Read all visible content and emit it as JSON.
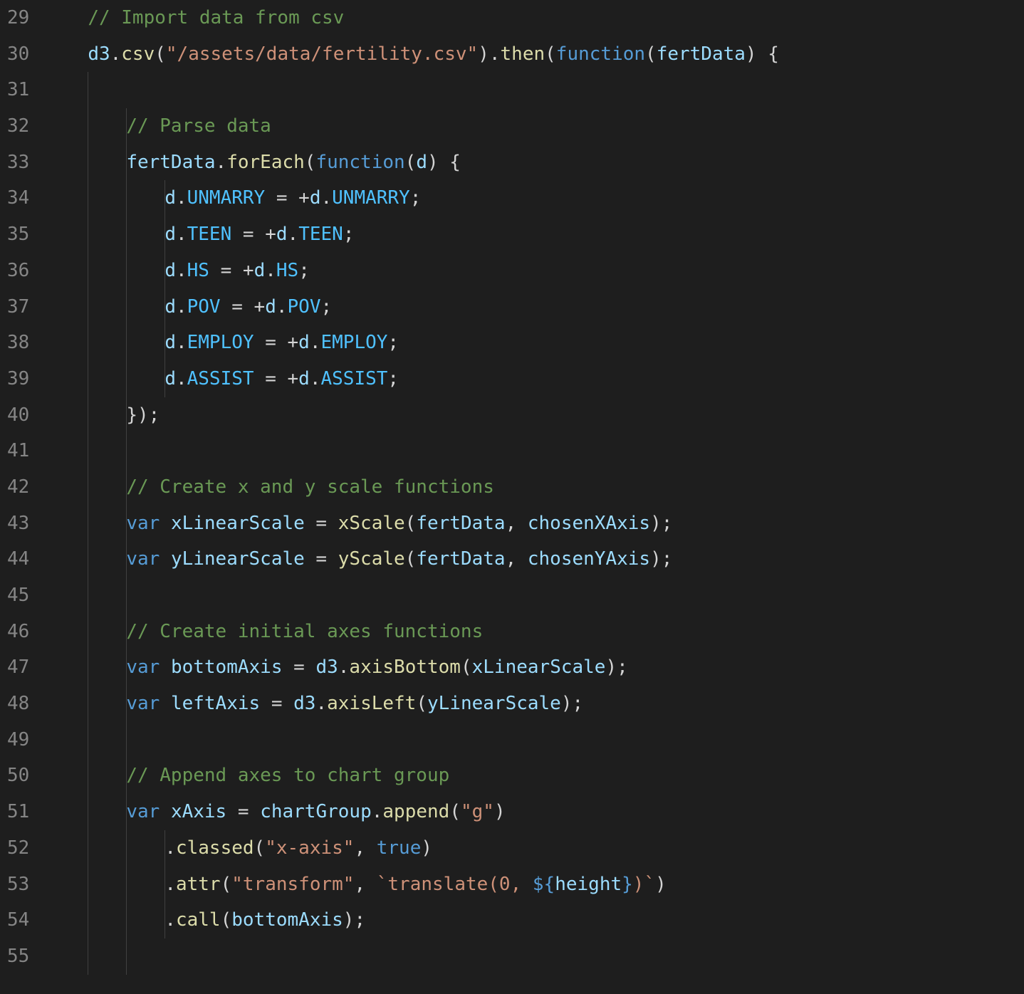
{
  "startLine": 29,
  "indentWidth": 54,
  "lines": [
    {
      "indent": 1,
      "tokens": [
        {
          "cls": "tok-comment",
          "text": "// Import data from csv"
        }
      ]
    },
    {
      "indent": 1,
      "tokens": [
        {
          "cls": "tok-var",
          "text": "d3"
        },
        {
          "cls": "tok-plain",
          "text": "."
        },
        {
          "cls": "tok-func",
          "text": "csv"
        },
        {
          "cls": "tok-plain",
          "text": "("
        },
        {
          "cls": "tok-string",
          "text": "\"/assets/data/fertility.csv\""
        },
        {
          "cls": "tok-plain",
          "text": ")."
        },
        {
          "cls": "tok-func",
          "text": "then"
        },
        {
          "cls": "tok-plain",
          "text": "("
        },
        {
          "cls": "tok-type",
          "text": "function"
        },
        {
          "cls": "tok-plain",
          "text": "("
        },
        {
          "cls": "tok-var",
          "text": "fertData"
        },
        {
          "cls": "tok-plain",
          "text": ") {"
        }
      ]
    },
    {
      "indent": 1,
      "guides": [
        1
      ],
      "tokens": []
    },
    {
      "indent": 2,
      "guides": [
        1,
        2
      ],
      "tokens": [
        {
          "cls": "tok-comment",
          "text": "// Parse data"
        }
      ]
    },
    {
      "indent": 2,
      "guides": [
        1,
        2
      ],
      "tokens": [
        {
          "cls": "tok-var",
          "text": "fertData"
        },
        {
          "cls": "tok-plain",
          "text": "."
        },
        {
          "cls": "tok-func",
          "text": "forEach"
        },
        {
          "cls": "tok-plain",
          "text": "("
        },
        {
          "cls": "tok-type",
          "text": "function"
        },
        {
          "cls": "tok-plain",
          "text": "("
        },
        {
          "cls": "tok-var",
          "text": "d"
        },
        {
          "cls": "tok-plain",
          "text": ") {"
        }
      ]
    },
    {
      "indent": 3,
      "guides": [
        1,
        2,
        3
      ],
      "tokens": [
        {
          "cls": "tok-var",
          "text": "d"
        },
        {
          "cls": "tok-plain",
          "text": "."
        },
        {
          "cls": "tok-const",
          "text": "UNMARRY"
        },
        {
          "cls": "tok-plain",
          "text": " = +"
        },
        {
          "cls": "tok-var",
          "text": "d"
        },
        {
          "cls": "tok-plain",
          "text": "."
        },
        {
          "cls": "tok-const",
          "text": "UNMARRY"
        },
        {
          "cls": "tok-plain",
          "text": ";"
        }
      ]
    },
    {
      "indent": 3,
      "guides": [
        1,
        2,
        3
      ],
      "tokens": [
        {
          "cls": "tok-var",
          "text": "d"
        },
        {
          "cls": "tok-plain",
          "text": "."
        },
        {
          "cls": "tok-const",
          "text": "TEEN"
        },
        {
          "cls": "tok-plain",
          "text": " = +"
        },
        {
          "cls": "tok-var",
          "text": "d"
        },
        {
          "cls": "tok-plain",
          "text": "."
        },
        {
          "cls": "tok-const",
          "text": "TEEN"
        },
        {
          "cls": "tok-plain",
          "text": ";"
        }
      ]
    },
    {
      "indent": 3,
      "guides": [
        1,
        2,
        3
      ],
      "tokens": [
        {
          "cls": "tok-var",
          "text": "d"
        },
        {
          "cls": "tok-plain",
          "text": "."
        },
        {
          "cls": "tok-const",
          "text": "HS"
        },
        {
          "cls": "tok-plain",
          "text": " = +"
        },
        {
          "cls": "tok-var",
          "text": "d"
        },
        {
          "cls": "tok-plain",
          "text": "."
        },
        {
          "cls": "tok-const",
          "text": "HS"
        },
        {
          "cls": "tok-plain",
          "text": ";"
        }
      ]
    },
    {
      "indent": 3,
      "guides": [
        1,
        2,
        3
      ],
      "tokens": [
        {
          "cls": "tok-var",
          "text": "d"
        },
        {
          "cls": "tok-plain",
          "text": "."
        },
        {
          "cls": "tok-const",
          "text": "POV"
        },
        {
          "cls": "tok-plain",
          "text": " = +"
        },
        {
          "cls": "tok-var",
          "text": "d"
        },
        {
          "cls": "tok-plain",
          "text": "."
        },
        {
          "cls": "tok-const",
          "text": "POV"
        },
        {
          "cls": "tok-plain",
          "text": ";"
        }
      ]
    },
    {
      "indent": 3,
      "guides": [
        1,
        2,
        3
      ],
      "tokens": [
        {
          "cls": "tok-var",
          "text": "d"
        },
        {
          "cls": "tok-plain",
          "text": "."
        },
        {
          "cls": "tok-const",
          "text": "EMPLOY"
        },
        {
          "cls": "tok-plain",
          "text": " = +"
        },
        {
          "cls": "tok-var",
          "text": "d"
        },
        {
          "cls": "tok-plain",
          "text": "."
        },
        {
          "cls": "tok-const",
          "text": "EMPLOY"
        },
        {
          "cls": "tok-plain",
          "text": ";"
        }
      ]
    },
    {
      "indent": 3,
      "guides": [
        1,
        2,
        3
      ],
      "tokens": [
        {
          "cls": "tok-var",
          "text": "d"
        },
        {
          "cls": "tok-plain",
          "text": "."
        },
        {
          "cls": "tok-const",
          "text": "ASSIST"
        },
        {
          "cls": "tok-plain",
          "text": " = +"
        },
        {
          "cls": "tok-var",
          "text": "d"
        },
        {
          "cls": "tok-plain",
          "text": "."
        },
        {
          "cls": "tok-const",
          "text": "ASSIST"
        },
        {
          "cls": "tok-plain",
          "text": ";"
        }
      ]
    },
    {
      "indent": 2,
      "guides": [
        1,
        2
      ],
      "tokens": [
        {
          "cls": "tok-plain",
          "text": "});"
        }
      ]
    },
    {
      "indent": 1,
      "guides": [
        1,
        2
      ],
      "tokens": []
    },
    {
      "indent": 2,
      "guides": [
        1,
        2
      ],
      "tokens": [
        {
          "cls": "tok-comment",
          "text": "// Create x and y scale functions"
        }
      ]
    },
    {
      "indent": 2,
      "guides": [
        1,
        2
      ],
      "tokens": [
        {
          "cls": "tok-type",
          "text": "var"
        },
        {
          "cls": "tok-plain",
          "text": " "
        },
        {
          "cls": "tok-var",
          "text": "xLinearScale"
        },
        {
          "cls": "tok-plain",
          "text": " = "
        },
        {
          "cls": "tok-func",
          "text": "xScale"
        },
        {
          "cls": "tok-plain",
          "text": "("
        },
        {
          "cls": "tok-var",
          "text": "fertData"
        },
        {
          "cls": "tok-plain",
          "text": ", "
        },
        {
          "cls": "tok-var",
          "text": "chosenXAxis"
        },
        {
          "cls": "tok-plain",
          "text": ");"
        }
      ]
    },
    {
      "indent": 2,
      "guides": [
        1,
        2
      ],
      "tokens": [
        {
          "cls": "tok-type",
          "text": "var"
        },
        {
          "cls": "tok-plain",
          "text": " "
        },
        {
          "cls": "tok-var",
          "text": "yLinearScale"
        },
        {
          "cls": "tok-plain",
          "text": " = "
        },
        {
          "cls": "tok-func",
          "text": "yScale"
        },
        {
          "cls": "tok-plain",
          "text": "("
        },
        {
          "cls": "tok-var",
          "text": "fertData"
        },
        {
          "cls": "tok-plain",
          "text": ", "
        },
        {
          "cls": "tok-var",
          "text": "chosenYAxis"
        },
        {
          "cls": "tok-plain",
          "text": ");"
        }
      ]
    },
    {
      "indent": 1,
      "guides": [
        1,
        2
      ],
      "tokens": []
    },
    {
      "indent": 2,
      "guides": [
        1,
        2
      ],
      "tokens": [
        {
          "cls": "tok-comment",
          "text": "// Create initial axes functions"
        }
      ]
    },
    {
      "indent": 2,
      "guides": [
        1,
        2
      ],
      "tokens": [
        {
          "cls": "tok-type",
          "text": "var"
        },
        {
          "cls": "tok-plain",
          "text": " "
        },
        {
          "cls": "tok-var",
          "text": "bottomAxis"
        },
        {
          "cls": "tok-plain",
          "text": " = "
        },
        {
          "cls": "tok-var",
          "text": "d3"
        },
        {
          "cls": "tok-plain",
          "text": "."
        },
        {
          "cls": "tok-func",
          "text": "axisBottom"
        },
        {
          "cls": "tok-plain",
          "text": "("
        },
        {
          "cls": "tok-var",
          "text": "xLinearScale"
        },
        {
          "cls": "tok-plain",
          "text": ");"
        }
      ]
    },
    {
      "indent": 2,
      "guides": [
        1,
        2
      ],
      "tokens": [
        {
          "cls": "tok-type",
          "text": "var"
        },
        {
          "cls": "tok-plain",
          "text": " "
        },
        {
          "cls": "tok-var",
          "text": "leftAxis"
        },
        {
          "cls": "tok-plain",
          "text": " = "
        },
        {
          "cls": "tok-var",
          "text": "d3"
        },
        {
          "cls": "tok-plain",
          "text": "."
        },
        {
          "cls": "tok-func",
          "text": "axisLeft"
        },
        {
          "cls": "tok-plain",
          "text": "("
        },
        {
          "cls": "tok-var",
          "text": "yLinearScale"
        },
        {
          "cls": "tok-plain",
          "text": ");"
        }
      ]
    },
    {
      "indent": 1,
      "guides": [
        1,
        2
      ],
      "tokens": []
    },
    {
      "indent": 2,
      "guides": [
        1,
        2
      ],
      "tokens": [
        {
          "cls": "tok-comment",
          "text": "// Append axes to chart group"
        }
      ]
    },
    {
      "indent": 2,
      "guides": [
        1,
        2
      ],
      "tokens": [
        {
          "cls": "tok-type",
          "text": "var"
        },
        {
          "cls": "tok-plain",
          "text": " "
        },
        {
          "cls": "tok-var",
          "text": "xAxis"
        },
        {
          "cls": "tok-plain",
          "text": " = "
        },
        {
          "cls": "tok-var",
          "text": "chartGroup"
        },
        {
          "cls": "tok-plain",
          "text": "."
        },
        {
          "cls": "tok-func",
          "text": "append"
        },
        {
          "cls": "tok-plain",
          "text": "("
        },
        {
          "cls": "tok-string",
          "text": "\"g\""
        },
        {
          "cls": "tok-plain",
          "text": ")"
        }
      ]
    },
    {
      "indent": 3,
      "guides": [
        1,
        2,
        3
      ],
      "tokens": [
        {
          "cls": "tok-plain",
          "text": "."
        },
        {
          "cls": "tok-func",
          "text": "classed"
        },
        {
          "cls": "tok-plain",
          "text": "("
        },
        {
          "cls": "tok-string",
          "text": "\"x-axis\""
        },
        {
          "cls": "tok-plain",
          "text": ", "
        },
        {
          "cls": "tok-bool",
          "text": "true"
        },
        {
          "cls": "tok-plain",
          "text": ")"
        }
      ]
    },
    {
      "indent": 3,
      "guides": [
        1,
        2,
        3
      ],
      "tokens": [
        {
          "cls": "tok-plain",
          "text": "."
        },
        {
          "cls": "tok-func",
          "text": "attr"
        },
        {
          "cls": "tok-plain",
          "text": "("
        },
        {
          "cls": "tok-string",
          "text": "\"transform\""
        },
        {
          "cls": "tok-plain",
          "text": ", "
        },
        {
          "cls": "tok-string",
          "text": "`translate(0, "
        },
        {
          "cls": "tok-template",
          "text": "${"
        },
        {
          "cls": "tok-var",
          "text": "height"
        },
        {
          "cls": "tok-template",
          "text": "}"
        },
        {
          "cls": "tok-string",
          "text": ")`"
        },
        {
          "cls": "tok-plain",
          "text": ")"
        }
      ]
    },
    {
      "indent": 3,
      "guides": [
        1,
        2,
        3
      ],
      "tokens": [
        {
          "cls": "tok-plain",
          "text": "."
        },
        {
          "cls": "tok-func",
          "text": "call"
        },
        {
          "cls": "tok-plain",
          "text": "("
        },
        {
          "cls": "tok-var",
          "text": "bottomAxis"
        },
        {
          "cls": "tok-plain",
          "text": ");"
        }
      ]
    },
    {
      "indent": 1,
      "guides": [
        1,
        2
      ],
      "tokens": []
    }
  ]
}
